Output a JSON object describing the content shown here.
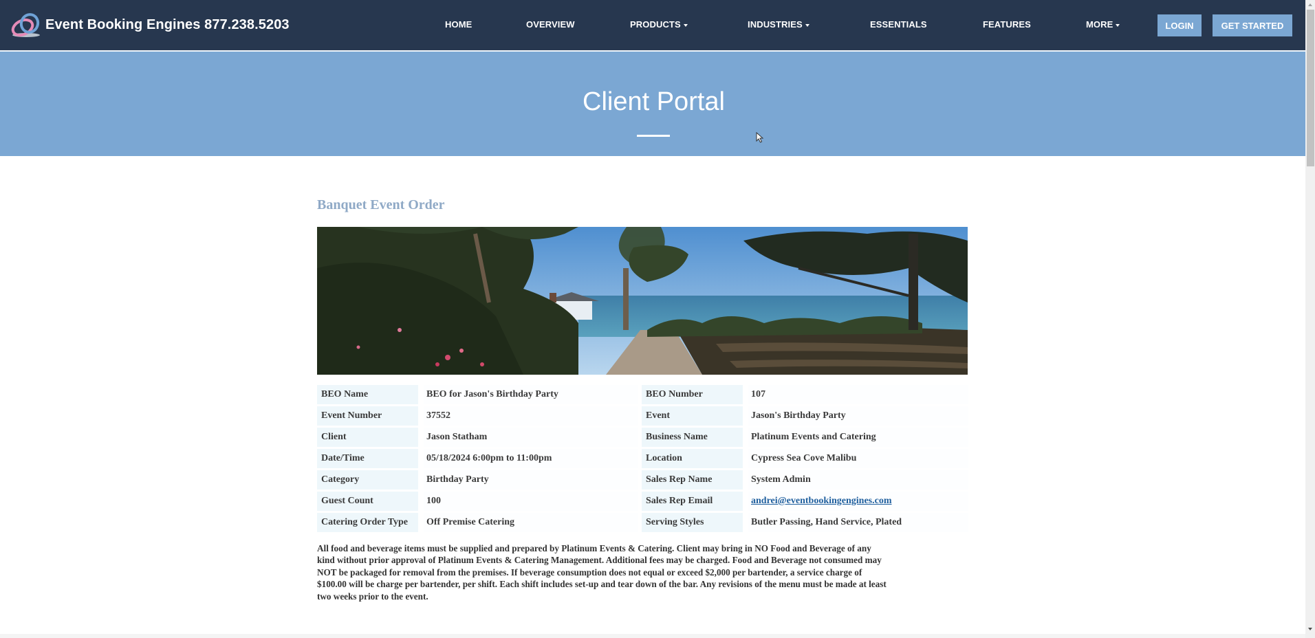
{
  "navbar": {
    "brand": "Event Booking Engines 877.238.5203",
    "logo_icon": "interlocking-rings-logo",
    "items": [
      {
        "label": "HOME",
        "dropdown": false
      },
      {
        "label": "OVERVIEW",
        "dropdown": false
      },
      {
        "label": "PRODUCTS",
        "dropdown": true
      },
      {
        "label": "INDUSTRIES",
        "dropdown": true
      },
      {
        "label": "ESSENTIALS",
        "dropdown": false
      },
      {
        "label": "FEATURES",
        "dropdown": false
      },
      {
        "label": "MORE",
        "dropdown": true
      }
    ],
    "login_label": "LOGIN",
    "get_started_label": "GET STARTED"
  },
  "hero": {
    "title": "Client Portal"
  },
  "beo": {
    "section_title": "Banquet Event Order",
    "banner_alt": "Coastal garden venue with cypress trees overlooking the ocean",
    "left": [
      {
        "label": "BEO Name",
        "value": "BEO for Jason's Birthday Party"
      },
      {
        "label": "Event Number",
        "value": "37552"
      },
      {
        "label": "Client",
        "value": "Jason Statham"
      },
      {
        "label": "Date/Time",
        "value": "05/18/2024 6:00pm to 11:00pm"
      },
      {
        "label": "Category",
        "value": "Birthday Party"
      },
      {
        "label": "Guest Count",
        "value": "100"
      },
      {
        "label": "Catering Order Type",
        "value": "Off Premise Catering"
      }
    ],
    "right": [
      {
        "label": "BEO Number",
        "value": "107"
      },
      {
        "label": "Event",
        "value": "Jason's Birthday Party"
      },
      {
        "label": "Business Name",
        "value": "Platinum Events and Catering"
      },
      {
        "label": "Location",
        "value": "Cypress Sea Cove Malibu"
      },
      {
        "label": "Sales Rep Name",
        "value": "System Admin"
      },
      {
        "label": "Sales Rep Email",
        "value": "andrei@eventbookingengines.com",
        "link": true
      },
      {
        "label": "Serving Styles",
        "value": "Butler Passing, Hand Service, Plated"
      }
    ],
    "terms_lines": [
      "All food and beverage items must be supplied and prepared by Platinum Events & Catering. Client may bring in NO Food and Beverage of any",
      "kind without prior approval of Platinum Events & Catering Management. Additional fees may be charged. Food and Beverage not consumed may",
      "NOT be packaged for removal from the premises. If beverage consumption does not equal or exceed $2,000 per bartender, a service charge of",
      "$100.00 will be charge per bartender, per shift. Each shift includes set-up and tear down of the bar. Any revisions of the menu must be made at least",
      "two weeks prior to the event."
    ]
  },
  "colors": {
    "navbar_bg": "#27374f",
    "accent": "#7ba7d3",
    "label_bg": "#eef7fb",
    "section_title": "#8fa9c6",
    "link": "#1f5f9e"
  }
}
